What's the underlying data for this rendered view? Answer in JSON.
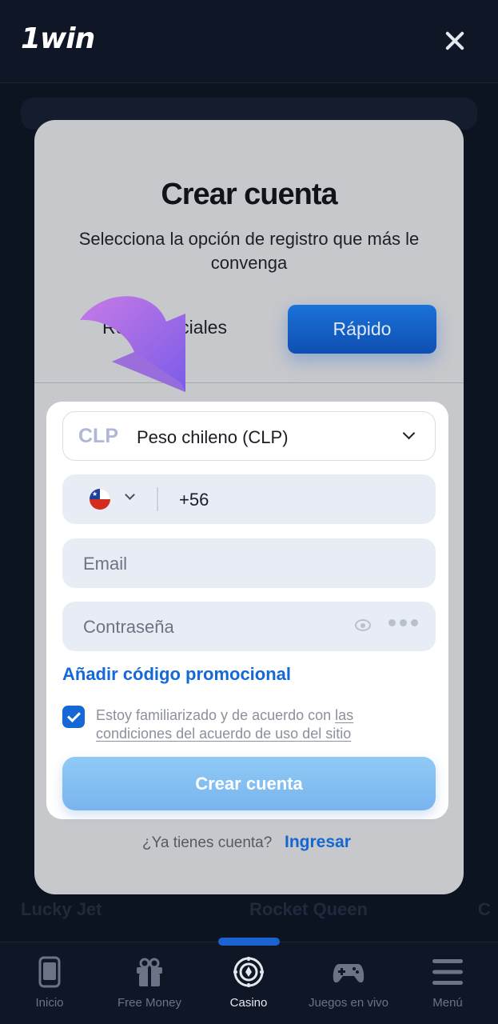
{
  "header": {
    "logo": "1win"
  },
  "background": {
    "games": [
      "Lucky Jet",
      "Rocket Queen",
      "C"
    ]
  },
  "modal": {
    "title": "Crear cuenta",
    "subtitle": "Selecciona la opción de registro que más le convenga",
    "tabs": {
      "social": "Redes sociales",
      "fast": "Rápido"
    },
    "currency": {
      "code": "CLP",
      "name": "Peso chileno (CLP)"
    },
    "phone": {
      "country": "Chile",
      "prefix": "+56"
    },
    "email_placeholder": "Email",
    "password_placeholder": "Contraseña",
    "promo_link": "Añadir código promocional",
    "terms_prefix": "Estoy familiarizado y de acuerdo con ",
    "terms_link": "las condiciones del acuerdo de uso del sitio",
    "terms_checked": true,
    "submit_label": "Crear cuenta",
    "login_question": "¿Ya tienes cuenta?",
    "login_link": "Ingresar"
  },
  "bottom_nav": {
    "items": [
      {
        "label": "Inicio",
        "icon": "phone-icon"
      },
      {
        "label": "Free Money",
        "icon": "gift-icon"
      },
      {
        "label": "Casino",
        "icon": "casino-chip-icon"
      },
      {
        "label": "Juegos en vivo",
        "icon": "gamepad-icon"
      },
      {
        "label": "Menú",
        "icon": "menu-icon"
      }
    ],
    "active_index": 2
  },
  "colors": {
    "accent": "#1568d6",
    "submit": "#8fcaf6",
    "background": "#0c1422"
  }
}
